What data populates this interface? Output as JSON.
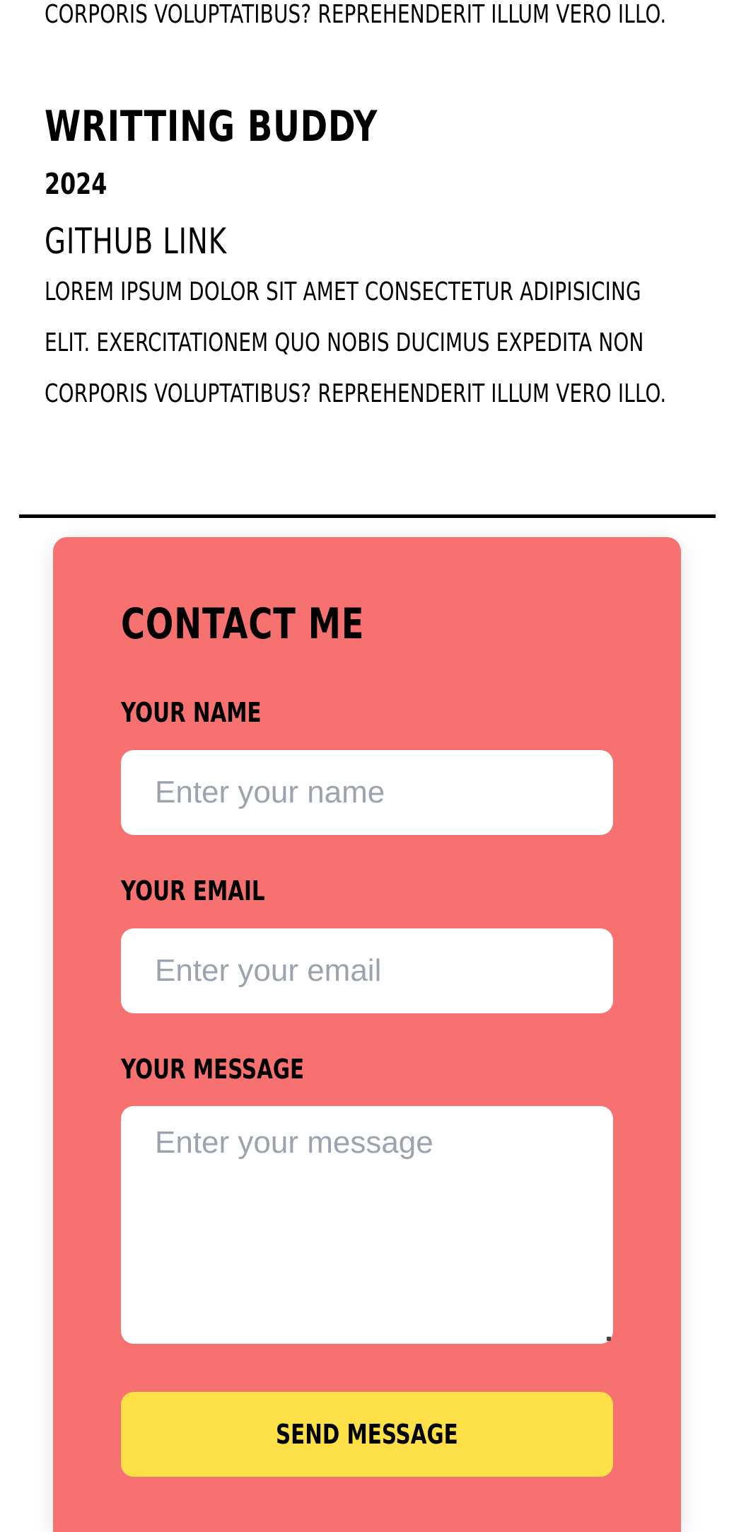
{
  "previous_project": {
    "description_tail": "CORPORIS VOLUPTATIBUS? REPREHENDERIT ILLUM VERO ILLO."
  },
  "project": {
    "title": "WRITTING BUDDY",
    "year": "2024",
    "link": "GITHUB LINK",
    "description_lines": [
      "LOREM IPSUM DOLOR SIT AMET CONSECTETUR ADIPISICING",
      "ELIT. EXERCITATIONEM QUO NOBIS DUCIMUS EXPEDITA NON",
      "CORPORIS VOLUPTATIBUS? REPREHENDERIT ILLUM VERO ILLO."
    ]
  },
  "contact": {
    "title": "CONTACT ME",
    "name_label": "YOUR NAME",
    "name_placeholder": "Enter your name",
    "email_label": "YOUR EMAIL",
    "email_placeholder": "Enter your email",
    "message_label": "YOUR MESSAGE",
    "message_placeholder": "Enter your message",
    "submit_label": "SEND MESSAGE"
  },
  "colors": {
    "card_background": "#f87171",
    "button_background": "#fde047",
    "placeholder": "#9ca3af"
  }
}
